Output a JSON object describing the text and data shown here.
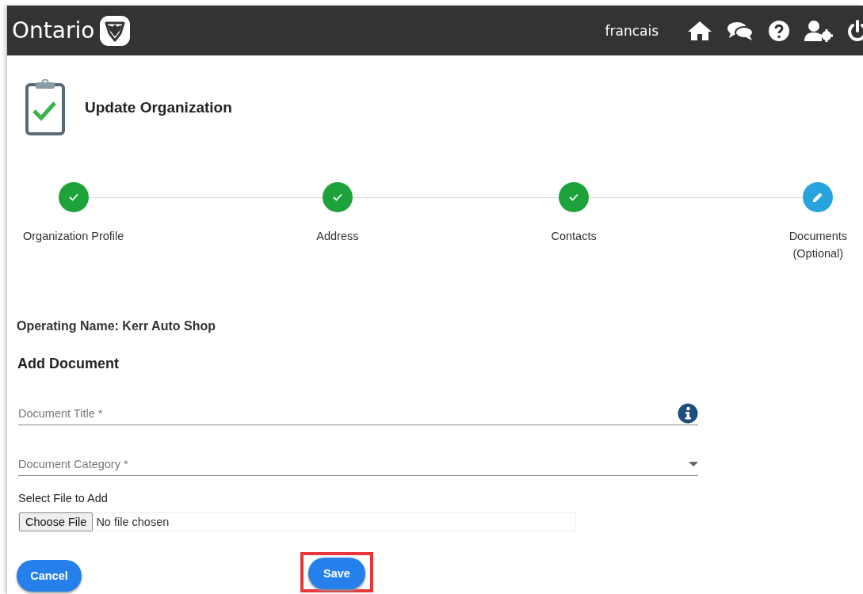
{
  "header": {
    "logo_text": "Ontario",
    "language_link": "francais"
  },
  "page": {
    "title": "Update Organization"
  },
  "steps": [
    {
      "label": "Organization Profile",
      "done": true
    },
    {
      "label": "Address",
      "done": true
    },
    {
      "label": "Contacts",
      "done": true
    },
    {
      "label": "Documents\n(Optional)",
      "done": false
    }
  ],
  "operating_name": "Operating Name: Kerr Auto Shop",
  "section_title": "Add Document",
  "fields": [
    {
      "kind": "text",
      "placeholder": "Document Title *"
    },
    {
      "kind": "select",
      "placeholder": "Document Category *"
    }
  ],
  "file_picker": {
    "label": "Select File to Add",
    "button": "Choose File",
    "status": "No file chosen"
  },
  "buttons": [
    {
      "label": "Cancel",
      "highlighted": false
    },
    {
      "label": "Save",
      "highlighted": true
    }
  ]
}
